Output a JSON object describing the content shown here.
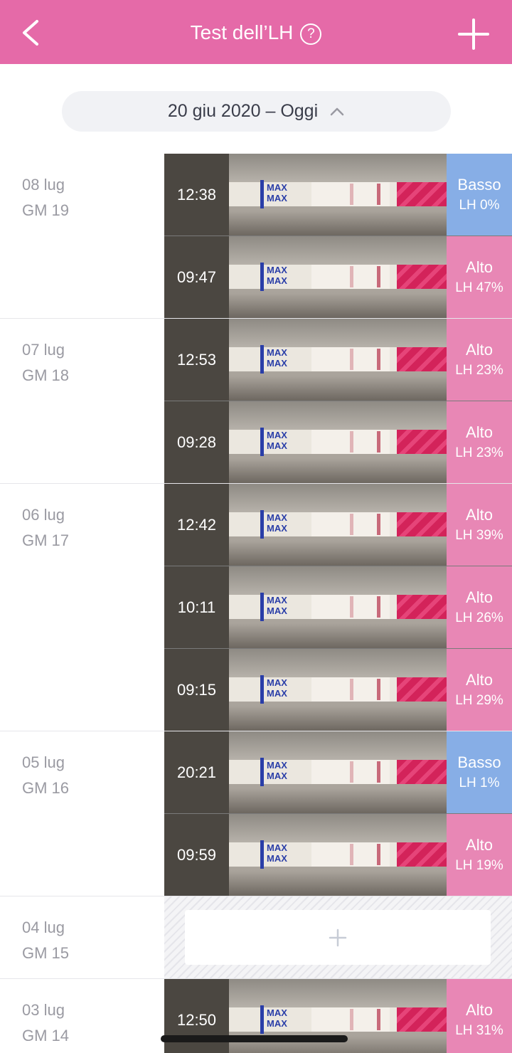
{
  "header": {
    "title": "Test dell’LH",
    "help_symbol": "?",
    "color": "#e56aa8"
  },
  "range": {
    "label": "20 giu 2020 – Oggi"
  },
  "strip_text": "MAX",
  "colors": {
    "alto": "#e887b5",
    "basso": "#87aee6"
  },
  "days": [
    {
      "date": "08 lug",
      "cycle_day": "GM 19",
      "entries": [
        {
          "time": "12:38",
          "level": "Basso",
          "lh": "LH 0%"
        },
        {
          "time": "09:47",
          "level": "Alto",
          "lh": "LH 47%"
        }
      ]
    },
    {
      "date": "07 lug",
      "cycle_day": "GM 18",
      "entries": [
        {
          "time": "12:53",
          "level": "Alto",
          "lh": "LH 23%"
        },
        {
          "time": "09:28",
          "level": "Alto",
          "lh": "LH 23%"
        }
      ]
    },
    {
      "date": "06 lug",
      "cycle_day": "GM 17",
      "entries": [
        {
          "time": "12:42",
          "level": "Alto",
          "lh": "LH 39%"
        },
        {
          "time": "10:11",
          "level": "Alto",
          "lh": "LH 26%"
        },
        {
          "time": "09:15",
          "level": "Alto",
          "lh": "LH 29%"
        }
      ]
    },
    {
      "date": "05 lug",
      "cycle_day": "GM 16",
      "entries": [
        {
          "time": "20:21",
          "level": "Basso",
          "lh": "LH 1%"
        },
        {
          "time": "09:59",
          "level": "Alto",
          "lh": "LH 19%"
        }
      ]
    },
    {
      "date": "04 lug",
      "cycle_day": "GM 15",
      "entries": []
    },
    {
      "date": "03 lug",
      "cycle_day": "GM 14",
      "entries": [
        {
          "time": "12:50",
          "level": "Alto",
          "lh": "LH 31%"
        }
      ]
    }
  ]
}
